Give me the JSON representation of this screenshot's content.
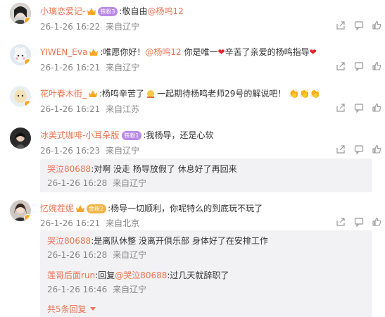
{
  "comments": [
    {
      "user": "小璃恋爱记-",
      "badge": "铁粉3",
      "text": ":敬自由",
      "mention": "@杨鸣12",
      "time": "26-1-26 16:22",
      "location": "来自辽宁"
    },
    {
      "user": "YIWEN_Eva",
      "text1": ":唯愿你好！",
      "mention": "@杨鸣12",
      "text2": " 你是唯一",
      "text3": "辛苦了亲爱的杨鸣指导",
      "time": "26-1-26 16:21",
      "location": "来自辽宁"
    },
    {
      "user": "花叶春木街_",
      "text1": ":杨鸣辛苦了",
      "text2": "一起期待杨鸣老师29号的解说吧！",
      "time": "26-1-26 16:21",
      "location": "来自江苏"
    },
    {
      "user": "冰美式咖啡-小耳朵版",
      "badge": "铁粉1",
      "text": ":我杨导，还是心软",
      "time": "26-1-26 16:23",
      "location": "来自辽宁",
      "reply": {
        "user": "哭泣80688",
        "text": ":对啊 没走  杨导放假了  休息好了再回来",
        "time": "26-1-26 16:28",
        "location": "来自辽宁"
      }
    },
    {
      "user": "忆婉茬妮",
      "badge": "金粉2",
      "text": ":杨导一切顺利，你呢特么的到底玩不玩了",
      "time": "26-1-26 16:21",
      "location": "来自北京",
      "replies": [
        {
          "user": "哭泣80688",
          "text": ":是离队休整 没离开俱乐部  身体好了在安排工作",
          "time": "26-1-26 16:28",
          "location": "来自辽宁"
        },
        {
          "user": "莲哥后面run",
          "prefix": ":回复",
          "mention": "@哭泣80688",
          "text": ":过几天就辞职了",
          "time": "26-1-26 16:46",
          "location": "来自辽宁"
        }
      ],
      "more_replies": "共5条回复"
    }
  ],
  "colors": {
    "link": "#eb7350",
    "text": "#333333",
    "meta": "#888888",
    "reply_bg": "#f2f2f5"
  },
  "icons": [
    "share-icon",
    "comment-icon",
    "like-icon"
  ]
}
